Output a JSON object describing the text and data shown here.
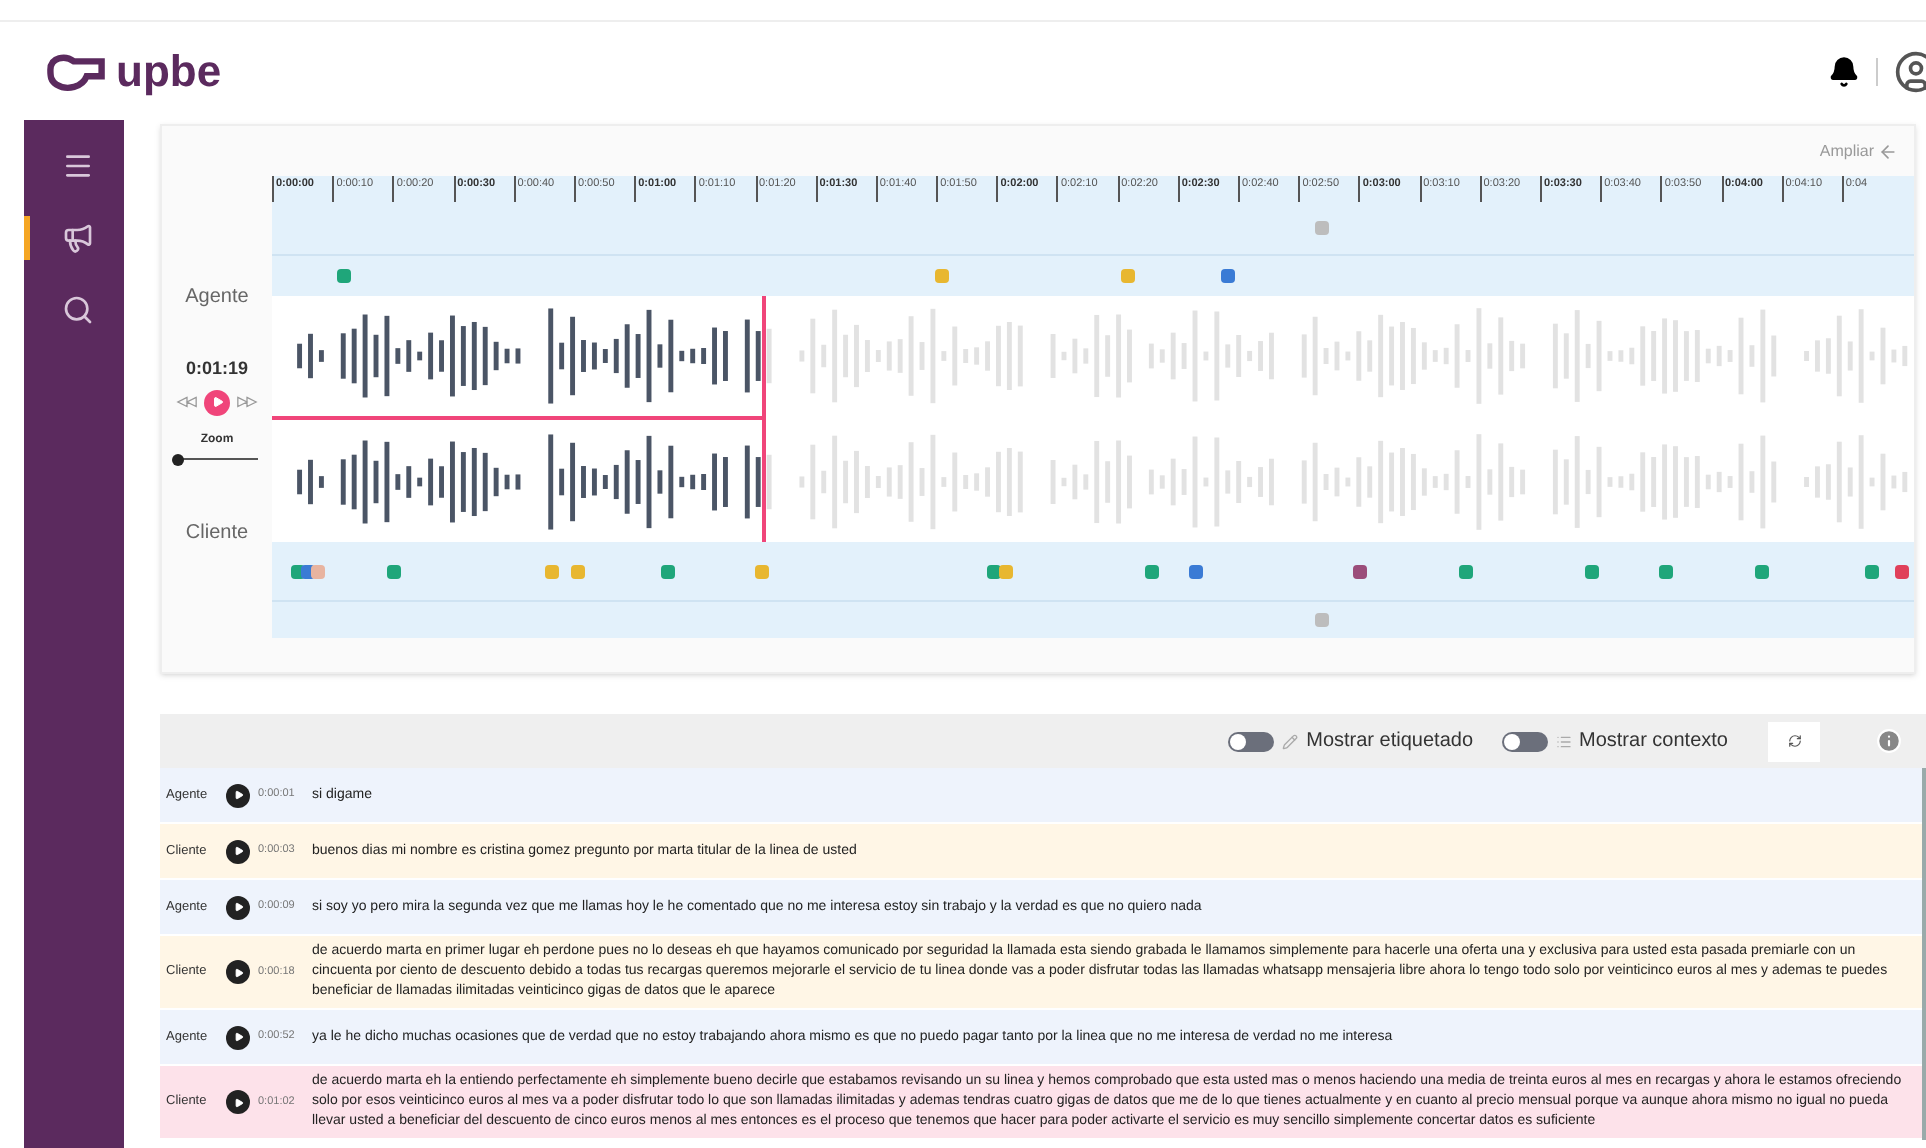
{
  "header": {
    "logo": "upbe"
  },
  "sidebar": {
    "items": [
      {
        "selected": false
      },
      {
        "selected": true
      },
      {
        "selected": false
      }
    ]
  },
  "timeline": {
    "zoom_label": "Ampliar",
    "ticks": [
      {
        "label": "0:00:00",
        "major": true
      },
      {
        "label": "0:00:10",
        "major": false
      },
      {
        "label": "0:00:20",
        "major": false
      },
      {
        "label": "0:00:30",
        "major": true
      },
      {
        "label": "0:00:40",
        "major": false
      },
      {
        "label": "0:00:50",
        "major": false
      },
      {
        "label": "0:01:00",
        "major": true
      },
      {
        "label": "0:01:10",
        "major": false
      },
      {
        "label": "0:01:20",
        "major": false
      },
      {
        "label": "0:01:30",
        "major": true
      },
      {
        "label": "0:01:40",
        "major": false
      },
      {
        "label": "0:01:50",
        "major": false
      },
      {
        "label": "0:02:00",
        "major": true
      },
      {
        "label": "0:02:10",
        "major": false
      },
      {
        "label": "0:02:20",
        "major": false
      },
      {
        "label": "0:02:30",
        "major": true
      },
      {
        "label": "0:02:40",
        "major": false
      },
      {
        "label": "0:02:50",
        "major": false
      },
      {
        "label": "0:03:00",
        "major": true
      },
      {
        "label": "0:03:10",
        "major": false
      },
      {
        "label": "0:03:20",
        "major": false
      },
      {
        "label": "0:03:30",
        "major": true
      },
      {
        "label": "0:03:40",
        "major": false
      },
      {
        "label": "0:03:50",
        "major": false
      },
      {
        "label": "0:04:00",
        "major": true
      },
      {
        "label": "0:04:10",
        "major": false
      },
      {
        "label": "0:04",
        "major": false
      }
    ],
    "agent": {
      "label": "Agente",
      "lanes": [
        {
          "markers": [
            {
              "level": 0.64,
              "color": "#bdbdbd"
            }
          ]
        },
        {
          "markers": [
            {
              "level": 0.044,
              "color": "#1fa67a"
            },
            {
              "level": 0.408,
              "color": "#e8b730"
            },
            {
              "level": 0.521,
              "color": "#e8b730"
            },
            {
              "level": 0.582,
              "color": "#3a7bd5"
            }
          ]
        }
      ]
    },
    "player": {
      "time": "0:01:19",
      "level": 0.299,
      "zoom_label": "Zoom",
      "zoom": {
        "level": 0
      }
    },
    "client": {
      "label": "Cliente",
      "lanes": [
        {
          "markers": [
            {
              "level": 0.016,
              "color": "#1fa67a"
            },
            {
              "level": 0.022,
              "color": "#3a7bd5"
            },
            {
              "level": 0.028,
              "color": "#e8b4a0"
            },
            {
              "level": 0.074,
              "color": "#1fa67a"
            },
            {
              "level": 0.171,
              "color": "#e8b730"
            },
            {
              "level": 0.186,
              "color": "#e8b730"
            },
            {
              "level": 0.241,
              "color": "#1fa67a"
            },
            {
              "level": 0.299,
              "color": "#e8b730"
            },
            {
              "level": 0.44,
              "color": "#1fa67a"
            },
            {
              "level": 0.447,
              "color": "#e8b730"
            },
            {
              "level": 0.536,
              "color": "#1fa67a"
            },
            {
              "level": 0.563,
              "color": "#3a7bd5"
            },
            {
              "level": 0.662,
              "color": "#9b4d7a"
            },
            {
              "level": 0.727,
              "color": "#1fa67a"
            },
            {
              "level": 0.804,
              "color": "#1fa67a"
            },
            {
              "level": 0.849,
              "color": "#1fa67a"
            },
            {
              "level": 0.908,
              "color": "#1fa67a"
            },
            {
              "level": 0.974,
              "color": "#1fa67a"
            },
            {
              "level": 0.993,
              "color": "#e0405a"
            }
          ]
        },
        {
          "markers": [
            {
              "level": 0.64,
              "color": "#bdbdbd"
            }
          ]
        }
      ]
    }
  },
  "toolbar": {
    "toggles": [
      {
        "label": "Mostrar etiquetado",
        "on": false
      },
      {
        "label": "Mostrar contexto",
        "on": false
      }
    ]
  },
  "transcript": [
    {
      "speaker": "Agente",
      "time": "0:00:01",
      "text": "si digame",
      "color": "#eef3fc"
    },
    {
      "speaker": "Cliente",
      "time": "0:00:03",
      "text": "buenos dias mi nombre es cristina gomez pregunto por marta titular de la linea de usted",
      "color": "#fff6e6"
    },
    {
      "speaker": "Agente",
      "time": "0:00:09",
      "text": "si soy yo pero mira la segunda vez que me llamas hoy le he comentado que no me interesa estoy sin trabajo y la verdad es que no quiero nada",
      "color": "#eef3fc"
    },
    {
      "speaker": "Cliente",
      "time": "0:00:18",
      "text": "de acuerdo marta en primer lugar eh perdone pues no lo deseas eh que hayamos comunicado por seguridad la llamada esta siendo grabada le llamamos simplemente para hacerle una oferta una y exclusiva para usted esta pasada premiarle con un cincuenta por ciento de descuento debido a todas tus recargas queremos mejorarle el servicio de tu linea donde vas a poder disfrutar todas las llamadas whatsapp mensajeria libre ahora lo tengo todo solo por veinticinco euros al mes y ademas te puedes beneficiar de llamadas ilimitadas veinticinco gigas de datos que le aparece",
      "color": "#fff6e6"
    },
    {
      "speaker": "Agente",
      "time": "0:00:52",
      "text": "ya le he dicho muchas ocasiones que de verdad que no estoy trabajando ahora mismo es que no puedo pagar tanto por la linea que no me interesa de verdad no me interesa",
      "color": "#eef3fc"
    },
    {
      "speaker": "Cliente",
      "time": "0:01:02",
      "text": "de acuerdo marta eh la entiendo perfectamente eh simplemente bueno decirle que estabamos revisando un su linea y hemos comprobado que esta usted mas o menos haciendo una media de treinta euros al mes en recargas y ahora le estamos ofreciendo solo por esos veinticinco euros al mes va a poder disfrutar todo lo que son llamadas ilimitadas y ademas tendras cuatro gigas de datos que me de lo que tienes actualmente y en cuanto al precio mensual porque va aunque ahora mismo no igual no pueda llevar usted a beneficiar del descuento de cinco euros menos al mes entonces es el proceso que tenemos que hacer para poder activarte el servicio es muy sencillo simplemente concertar datos es suficiente",
      "color": "#fde2ea"
    }
  ]
}
